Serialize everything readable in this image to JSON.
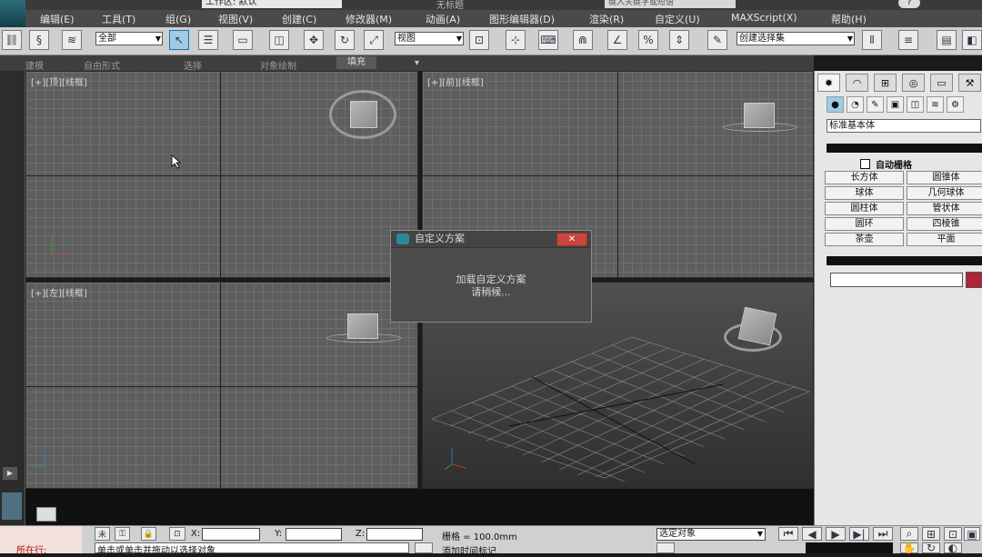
{
  "title_bar": {
    "workspace": "工作区: 默认",
    "window_title": "无标题",
    "search_placeholder": "键入关键字或短语",
    "help": "?"
  },
  "menu": [
    "编辑(E)",
    "工具(T)",
    "组(G)",
    "视图(V)",
    "创建(C)",
    "修改器(M)",
    "动画(A)",
    "图形编辑器(D)",
    "渲染(R)",
    "自定义(U)",
    "MAXScript(X)",
    "帮助(H)"
  ],
  "toolbar": {
    "selection_filter": "全部",
    "reference_coord": "视图",
    "named_selection": "创建选择集"
  },
  "ribbon": {
    "tabs": [
      "建模",
      "自由形式",
      "选择",
      "对象绘制",
      "填充"
    ],
    "active_tab": "填充"
  },
  "viewports": {
    "top": "[+][顶][线框]",
    "front": "[+][前][线框]",
    "left": "[+][左][线框]"
  },
  "dialog": {
    "title": "自定义方案",
    "message_line1": "加载自定义方案",
    "message_line2": "请稍候..."
  },
  "command_panel": {
    "category": "标准基本体",
    "autogrid": "自动栅格",
    "objects": [
      "长方体",
      "圆锥体",
      "球体",
      "几何球体",
      "圆柱体",
      "管状体",
      "圆环",
      "四棱锥",
      "茶壶",
      "平面"
    ],
    "colors": {
      "swatch": "#b0213a",
      "selected_btn": "#9ecbe8"
    }
  },
  "status_bar": {
    "left_status": "所在行:",
    "x_label": "X:",
    "y_label": "Y:",
    "z_label": "Z:",
    "grid": "栅格 = 100.0mm",
    "selection_mode": "选定对象",
    "prompt": "单击或单击并拖动以选择对象",
    "add_time_tag": "添加时间标记"
  }
}
